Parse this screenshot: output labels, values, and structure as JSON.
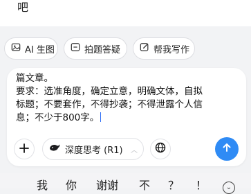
{
  "top": {
    "text": "吧"
  },
  "chips": [
    {
      "label": "AI 生图",
      "icon": "image-icon"
    },
    {
      "label": "拍题答疑",
      "icon": "scan-icon"
    },
    {
      "label": "帮我写作",
      "icon": "pen-icon"
    }
  ],
  "composer": {
    "lines": [
      "篇文章。",
      "要求：选准角度，确定立意，明确文体，自拟",
      "标题；不要套作，不得抄袭；不得泄露个人信",
      "息；不少于800字。"
    ],
    "mode_label": "深度思考 (R1)"
  },
  "keyboard": {
    "suggestions": [
      "我",
      "你",
      "谢谢",
      "不",
      "？",
      "！"
    ]
  },
  "colors": {
    "send_button": "#2f8bf5",
    "cursor": "#2b6cf6"
  }
}
